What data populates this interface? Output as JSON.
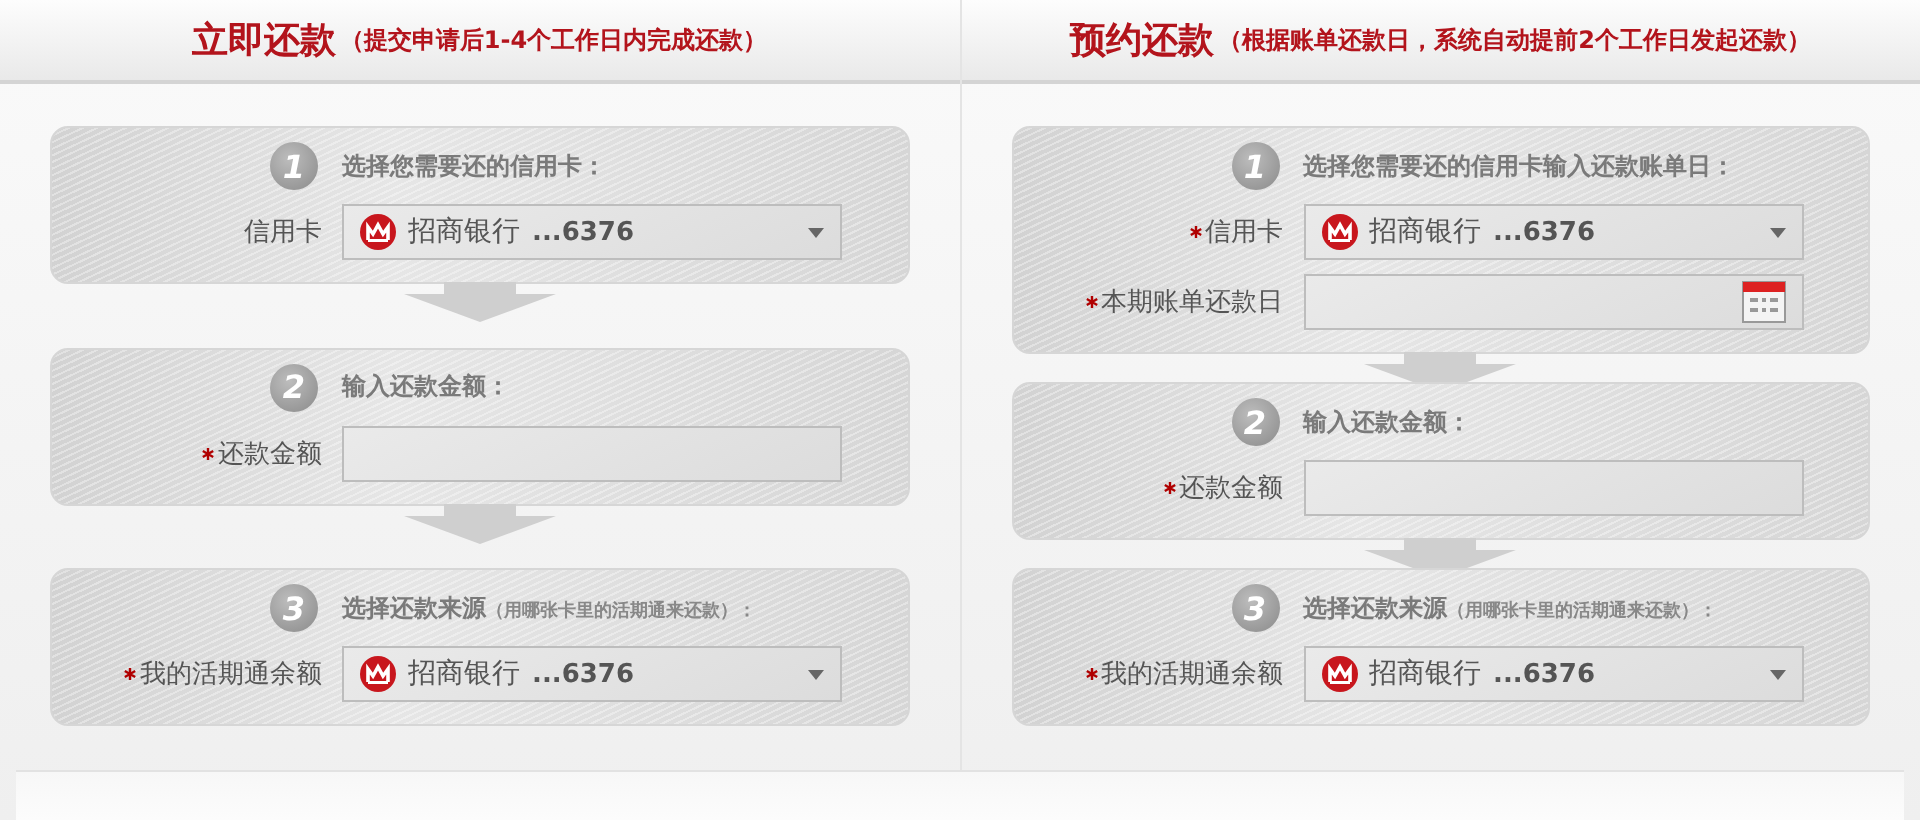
{
  "columns": [
    {
      "title": "立即还款",
      "subtitle": "（提交申请后1-4个工作日内完成还款）",
      "steps": [
        {
          "number": "1",
          "title": "选择您需要还的信用卡：",
          "fields": [
            {
              "kind": "select",
              "label": "信用卡",
              "required": false,
              "bank": "招商银行",
              "card": "...6376"
            }
          ]
        },
        {
          "number": "2",
          "title": "输入还款金额：",
          "fields": [
            {
              "kind": "text",
              "label": "还款金额",
              "required": true
            }
          ]
        },
        {
          "number": "3",
          "title": "选择还款来源",
          "note": "（用哪张卡里的活期通来还款）：",
          "fields": [
            {
              "kind": "select",
              "label": "我的活期通余额",
              "required": true,
              "bank": "招商银行",
              "card": "...6376"
            }
          ]
        }
      ]
    },
    {
      "title": "预约还款",
      "subtitle": "（根据账单还款日，系统自动提前2个工作日发起还款）",
      "steps": [
        {
          "number": "1",
          "title": "选择您需要还的信用卡输入还款账单日：",
          "fields": [
            {
              "kind": "select",
              "label": "信用卡",
              "required": true,
              "bank": "招商银行",
              "card": "...6376"
            },
            {
              "kind": "date",
              "label": "本期账单还款日",
              "required": true
            }
          ]
        },
        {
          "number": "2",
          "title": "输入还款金额：",
          "fields": [
            {
              "kind": "text",
              "label": "还款金额",
              "required": true
            }
          ]
        },
        {
          "number": "3",
          "title": "选择还款来源",
          "note": "（用哪张卡里的活期通来还款）：",
          "fields": [
            {
              "kind": "select",
              "label": "我的活期通余额",
              "required": true,
              "bank": "招商银行",
              "card": "...6376"
            }
          ]
        }
      ]
    }
  ]
}
